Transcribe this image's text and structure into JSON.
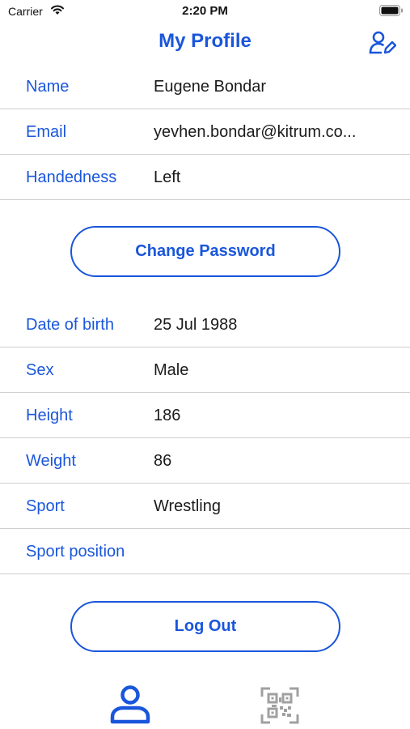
{
  "status_bar": {
    "carrier": "Carrier",
    "time": "2:20 PM"
  },
  "header": {
    "title": "My Profile",
    "edit_icon": "user-edit-icon"
  },
  "account": [
    {
      "label": "Name",
      "value": "Eugene Bondar"
    },
    {
      "label": "Email",
      "value": "yevhen.bondar@kitrum.co..."
    },
    {
      "label": "Handedness",
      "value": "Left"
    }
  ],
  "change_password_label": "Change Password",
  "details": [
    {
      "label": "Date of birth",
      "value": "25 Jul 1988"
    },
    {
      "label": "Sex",
      "value": "Male"
    },
    {
      "label": "Height",
      "value": "186"
    },
    {
      "label": "Weight",
      "value": "86"
    },
    {
      "label": "Sport",
      "value": "Wrestling"
    },
    {
      "label": "Sport position",
      "value": ""
    }
  ],
  "logout_label": "Log Out",
  "tab_bar": {
    "items": [
      {
        "icon": "profile-icon",
        "active": true
      },
      {
        "icon": "qr-code-icon",
        "active": false
      }
    ]
  },
  "colors": {
    "accent": "#1a56db",
    "divider": "#cfcfcf",
    "inactive_icon": "#a0a0a0"
  }
}
